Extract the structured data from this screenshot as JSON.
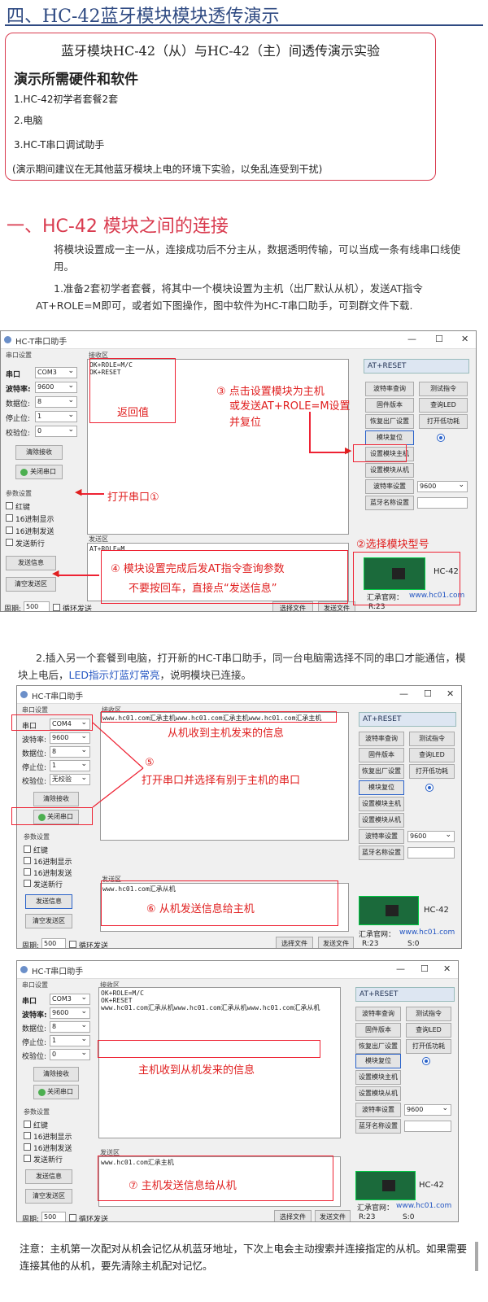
{
  "title": "四、HC-42蓝牙模块模块透传演示",
  "intro": {
    "heading": "蓝牙模块HC-42（从）与HC-42（主）间透传演示实验",
    "subheading": "演示所需硬件和软件",
    "items": [
      "1.HC-42初学者套餐2套",
      "2.电脑",
      "3.HC-T串口调试助手"
    ],
    "note": "(演示期间建议在无其他蓝牙模块上电的环境下实验，以免乱连受到干扰)"
  },
  "section1": {
    "title": "一、HC-42 模块之间的连接",
    "para1": "将模块设置成一主一从，连接成功后不分主从，数据透明传输，可以当成一条有线串口线使用。",
    "step1": "1.准备2套初学者套餐，将其中一个模块设置为主机（出厂默认从机），发送AT指令AT+ROLE=M即可，或者如下图操作，图中软件为HC-T串口助手，可到群文件下载.",
    "step2_a": "2.插入另一个套餐到电脑，打开新的HC-T串口助手，同一台电脑需选择不同的串口才能通信，模块上电后，",
    "step2_b": "LED指示灯蓝灯常亮",
    "step2_c": "，说明模块已连接。"
  },
  "app": {
    "title": "HC-T串口助手",
    "serial_group": "串口设置",
    "port_label": "串口",
    "baud_label": "波特率:",
    "databits_label": "数据位:",
    "stopbits_label": "停止位:",
    "parity_label": "校验位:",
    "baud": "9600",
    "databits": "8",
    "stopbits": "1",
    "clear_recv": "清除接收",
    "close_port": "关闭串口",
    "param_group": "参数设置",
    "opt_red": "红键",
    "opt_hex_show": "16进制显示",
    "opt_hex_send": "16进制发送",
    "opt_newline": "发送新行",
    "send_btn": "发送信息",
    "clear_send": "清空发送区",
    "period_label": "周期:",
    "period": "500",
    "loop_send": "循环发送",
    "select_file": "选择文件",
    "send_file": "发送文件",
    "recv_label": "接收区",
    "send_label": "发送区",
    "at_reset": "AT+RESET",
    "btn_baud_query": "波特率查询",
    "btn_test": "测试指令",
    "btn_fw": "固件版本",
    "btn_led": "查询LED",
    "btn_factory": "恢复出厂设置",
    "btn_lowpower": "打开低功耗",
    "btn_reset": "模块复位",
    "btn_set_master": "设置模块主机",
    "btn_set_slave": "设置模块从机",
    "btn_baud_set": "波特率设置",
    "btn_name_set": "蓝牙名称设置",
    "module": "HC-42",
    "site_label": "汇承官网：",
    "site": "www.hc01.com",
    "r_label": "R:23",
    "s_label": "S:0"
  },
  "win1": {
    "port": "COM3",
    "parity": "0",
    "recv": "OK+ROLE=M/C\nOK+RESET",
    "send": "AT+ROLE=M",
    "ann_return": "返回值",
    "ann_open": "打开串口①",
    "ann_step3_a": "③ 点击设置模块为主机",
    "ann_step3_b": "或发送AT+ROLE=M设置",
    "ann_step3_c": "并复位",
    "ann_step2": "②选择模块型号",
    "ann_step4_a": "④ 模块设置完成后发AT指令查询参数",
    "ann_step4_b": "不要按回车，直接点“发送信息”"
  },
  "win2": {
    "port": "COM4",
    "parity": "无校验",
    "recv": "www.hc01.com汇承主机www.hc01.com汇承主机www.hc01.com汇承主机",
    "send": "www.hc01.com汇承从机",
    "ann_recv": "从机收到主机发来的信息",
    "ann_step5_num": "⑤",
    "ann_step5": "打开串口并选择有别于主机的串口",
    "ann_step6": "⑥ 从机发送信息给主机",
    "s_label": "S:0"
  },
  "win3": {
    "port": "COM3",
    "parity": "0",
    "recv": "OK+ROLE=M/C\nOK+RESET\nwww.hc01.com汇承从机www.hc01.com汇承从机www.hc01.com汇承从机",
    "send": "www.hc01.com汇承主机",
    "ann_recv": "主机收到从机发来的信息",
    "ann_step7": "⑦ 主机发送信息给从机",
    "s_label": "S:0"
  },
  "bottom_note": "注意：主机第一次配对从机会记忆从机蓝牙地址，下次上电会主动搜索并连接指定的从机。如果需要连接其他的从机，要先清除主机配对记忆。",
  "colors": {
    "accent_red": "#e02020",
    "title_blue": "#2f4a82",
    "led_blue": "#2a62c9"
  }
}
